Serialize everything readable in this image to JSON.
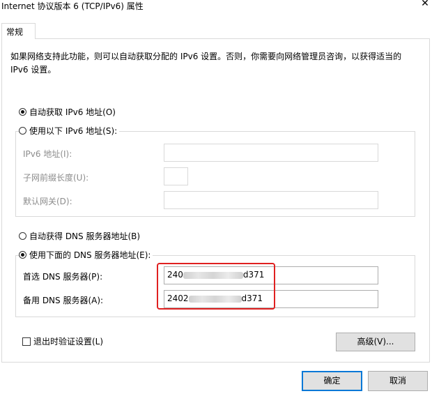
{
  "window": {
    "title": "Internet 协议版本 6 (TCP/IPv6) 属性",
    "close_glyph": "✕"
  },
  "tabs": [
    {
      "label": "常规"
    }
  ],
  "description": "如果网络支持此功能，则可以自动获取分配的 IPv6 设置。否则，你需要向网络管理员咨询，以获得适当的 IPv6 设置。",
  "ip_settings": {
    "auto_label": "自动获取 IPv6 地址(O)",
    "manual_label": "使用以下 IPv6 地址(S):",
    "selected": "auto",
    "address_label": "IPv6 地址(I):",
    "address_value": "",
    "prefix_label": "子网前缀长度(U):",
    "prefix_value": "",
    "gateway_label": "默认网关(D):",
    "gateway_value": ""
  },
  "dns_settings": {
    "auto_label": "自动获得 DNS 服务器地址(B)",
    "manual_label": "使用下面的 DNS 服务器地址(E):",
    "selected": "manual",
    "preferred_label": "首选 DNS 服务器(P):",
    "preferred_prefix": "240",
    "preferred_suffix": "d371",
    "alternate_label": "备用 DNS 服务器(A):",
    "alternate_prefix": "2402",
    "alternate_suffix": "d371"
  },
  "validate": {
    "label": "退出时验证设置(L)",
    "checked": false
  },
  "buttons": {
    "advanced": "高级(V)...",
    "ok": "确定",
    "cancel": "取消"
  },
  "colors": {
    "highlight": "#e02020",
    "default_button_border": "#0078d7",
    "disabled_text": "#8c8c8c"
  }
}
